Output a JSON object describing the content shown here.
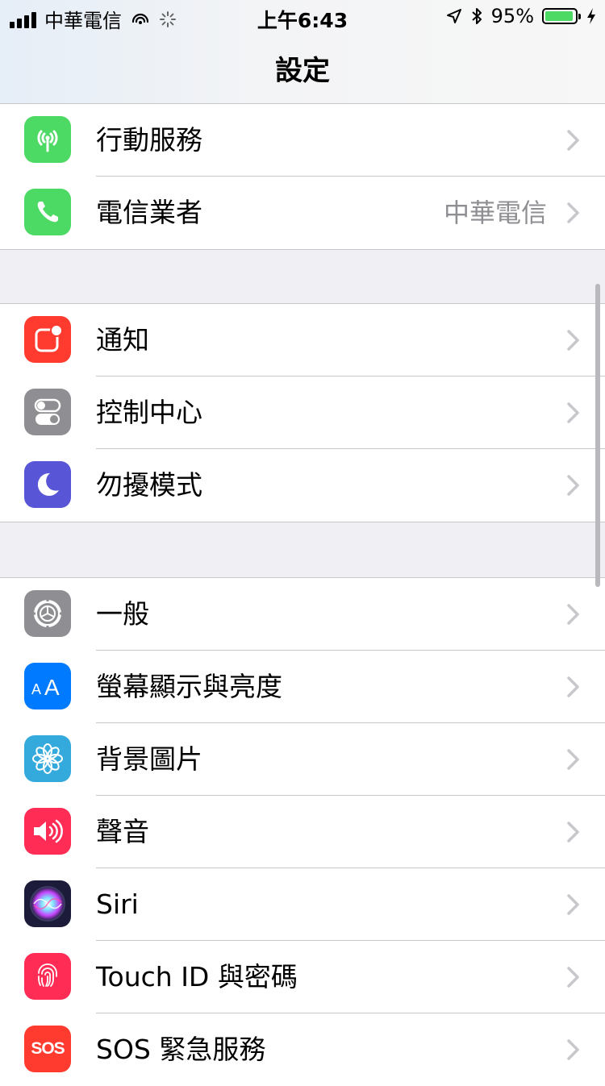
{
  "status_bar": {
    "carrier": "中華電信",
    "time": "上午6:43",
    "battery_percent": "95%",
    "battery_level": 0.95
  },
  "nav": {
    "title": "設定"
  },
  "groups": [
    {
      "items": [
        {
          "label": "行動服務",
          "icon": "cellular-antenna-icon",
          "color": "#4cd964"
        },
        {
          "label": "電信業者",
          "value": "中華電信",
          "icon": "phone-icon",
          "color": "#4cd964"
        }
      ]
    },
    {
      "items": [
        {
          "label": "通知",
          "icon": "notification-icon",
          "color": "#ff3b30"
        },
        {
          "label": "控制中心",
          "icon": "control-center-toggle-icon",
          "color": "#8e8e93"
        },
        {
          "label": "勿擾模式",
          "icon": "moon-icon",
          "color": "#5856d6"
        }
      ]
    },
    {
      "items": [
        {
          "label": "一般",
          "icon": "gear-icon",
          "color": "#8e8e93"
        },
        {
          "label": "螢幕顯示與亮度",
          "icon": "text-size-icon",
          "color": "#007aff"
        },
        {
          "label": "背景圖片",
          "icon": "flower-icon",
          "color": "#34aadc"
        },
        {
          "label": "聲音",
          "icon": "speaker-icon",
          "color": "#ff2d55"
        },
        {
          "label": "Siri",
          "icon": "siri-icon",
          "color": "#1c1c3a"
        },
        {
          "label": "Touch ID 與密碼",
          "icon": "fingerprint-icon",
          "color": "#ff2d55"
        },
        {
          "label": "SOS 緊急服務",
          "icon": "sos-icon",
          "icon_text": "SOS",
          "color": "#ff3b30"
        }
      ]
    }
  ]
}
